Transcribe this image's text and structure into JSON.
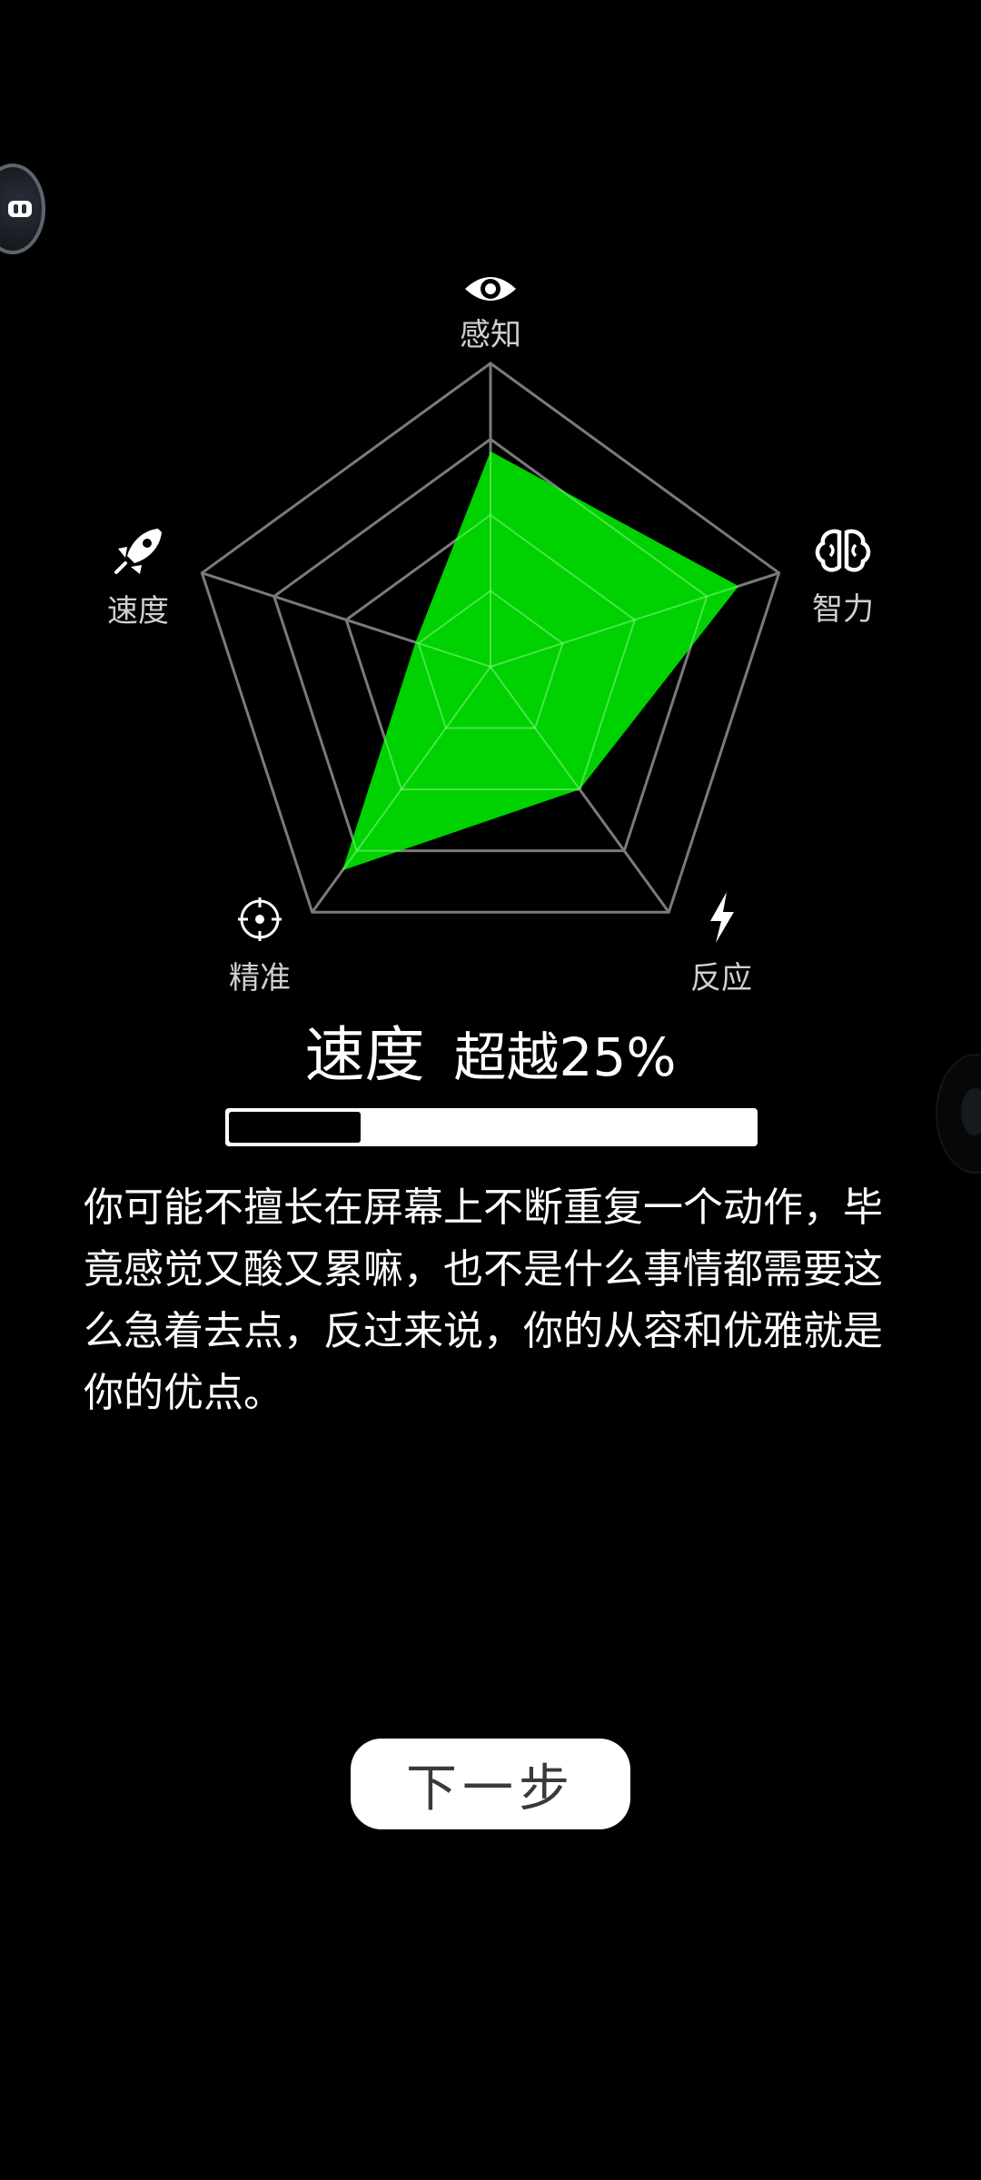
{
  "radar": {
    "axes": [
      {
        "label": "感知",
        "icon": "eye-icon"
      },
      {
        "label": "智力",
        "icon": "brain-icon"
      },
      {
        "label": "反应",
        "icon": "lightning-icon"
      },
      {
        "label": "精准",
        "icon": "crosshair-icon"
      },
      {
        "label": "速度",
        "icon": "rocket-icon"
      }
    ],
    "values": [
      0.71,
      0.86,
      0.5,
      0.83,
      0.26
    ],
    "levels": 4,
    "fill_color": "#00d100",
    "grid_color": "#7a7a7a"
  },
  "result": {
    "category": "速度",
    "percent_text": "超越25%",
    "progress": 0.25
  },
  "description": "你可能不擅长在屏幕上不断重复一个动作，毕竟感觉又酸又累嘛，也不是什么事情都需要这么急着去点，反过来说，你的从容和优雅就是你的优点。",
  "actions": {
    "next_label": "下一步"
  }
}
